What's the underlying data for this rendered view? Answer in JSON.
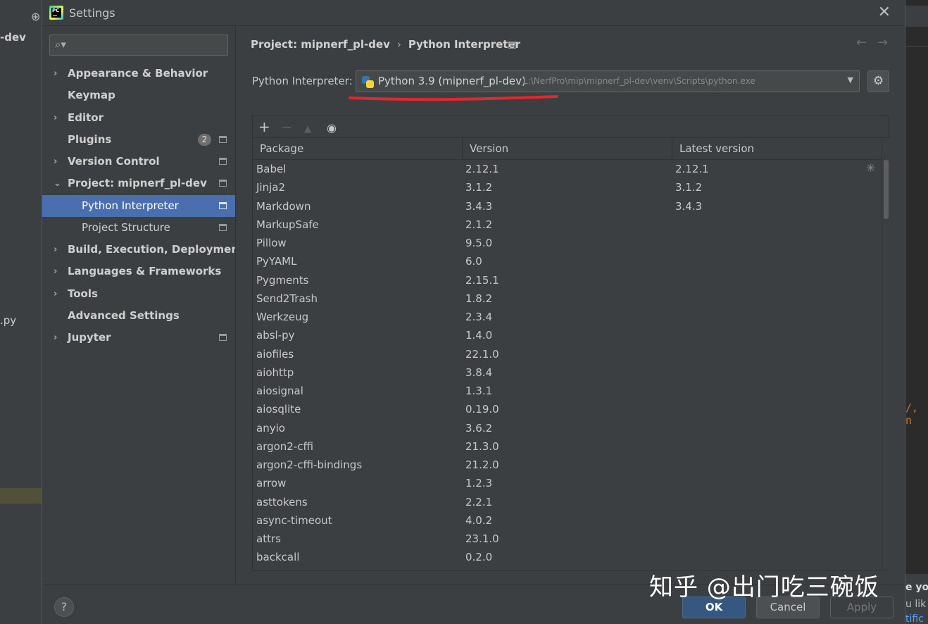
{
  "background": {
    "left_project": "-dev",
    "left_file": ".py",
    "right_code": "/, n",
    "right_notice_1": "e you",
    "right_notice_2": "u lik",
    "right_notice_3": "tific"
  },
  "dialog": {
    "title": "Settings",
    "app_icon_text": "PC"
  },
  "sidebar": {
    "search_placeholder": "",
    "items": [
      {
        "label": "Appearance & Behavior",
        "expandable": true
      },
      {
        "label": "Keymap",
        "expandable": false
      },
      {
        "label": "Editor",
        "expandable": true
      },
      {
        "label": "Plugins",
        "expandable": false,
        "badge": "2"
      },
      {
        "label": "Version Control",
        "expandable": true
      },
      {
        "label": "Project: mipnerf_pl-dev",
        "expandable": true,
        "expanded": true
      },
      {
        "label": "Python Interpreter",
        "sub": true,
        "selected": true
      },
      {
        "label": "Project Structure",
        "sub": true
      },
      {
        "label": "Build, Execution, Deployment",
        "expandable": true
      },
      {
        "label": "Languages & Frameworks",
        "expandable": true
      },
      {
        "label": "Tools",
        "expandable": true
      },
      {
        "label": "Advanced Settings",
        "expandable": false
      },
      {
        "label": "Jupyter",
        "expandable": true
      }
    ]
  },
  "breadcrumb": {
    "project": "Project: mipnerf_pl-dev",
    "page": "Python Interpreter"
  },
  "interpreter": {
    "label": "Python Interpreter:",
    "name": "Python 3.9 (mipnerf_pl-dev)",
    "path": "L:\\NerfPro\\mip\\mipnerf_pl-dev\\venv\\Scripts\\python.exe"
  },
  "table": {
    "columns": [
      "Package",
      "Version",
      "Latest version"
    ],
    "rows": [
      [
        "Babel",
        "2.12.1",
        "2.12.1"
      ],
      [
        "Jinja2",
        "3.1.2",
        "3.1.2"
      ],
      [
        "Markdown",
        "3.4.3",
        "3.4.3"
      ],
      [
        "MarkupSafe",
        "2.1.2",
        ""
      ],
      [
        "Pillow",
        "9.5.0",
        ""
      ],
      [
        "PyYAML",
        "6.0",
        ""
      ],
      [
        "Pygments",
        "2.15.1",
        ""
      ],
      [
        "Send2Trash",
        "1.8.2",
        ""
      ],
      [
        "Werkzeug",
        "2.3.4",
        ""
      ],
      [
        "absl-py",
        "1.4.0",
        ""
      ],
      [
        "aiofiles",
        "22.1.0",
        ""
      ],
      [
        "aiohttp",
        "3.8.4",
        ""
      ],
      [
        "aiosignal",
        "1.3.1",
        ""
      ],
      [
        "aiosqlite",
        "0.19.0",
        ""
      ],
      [
        "anyio",
        "3.6.2",
        ""
      ],
      [
        "argon2-cffi",
        "21.3.0",
        ""
      ],
      [
        "argon2-cffi-bindings",
        "21.2.0",
        ""
      ],
      [
        "arrow",
        "1.2.3",
        ""
      ],
      [
        "asttokens",
        "2.2.1",
        ""
      ],
      [
        "async-timeout",
        "4.0.2",
        ""
      ],
      [
        "attrs",
        "23.1.0",
        ""
      ],
      [
        "backcall",
        "0.2.0",
        ""
      ]
    ]
  },
  "footer": {
    "help": "?",
    "ok": "OK",
    "cancel": "Cancel",
    "apply": "Apply"
  },
  "watermark": "知乎 @出门吃三碗饭",
  "colors": {
    "selection": "#4b6eaf",
    "ok_button": "#365880",
    "annotation_underline": "#e0282e"
  },
  "icons": {
    "back": "arrow-left-icon",
    "forward": "arrow-right-icon",
    "gear": "gear-icon",
    "add": "plus-icon",
    "remove": "minus-icon",
    "upgrade": "triangle-up-icon",
    "show_early": "eye-icon"
  }
}
